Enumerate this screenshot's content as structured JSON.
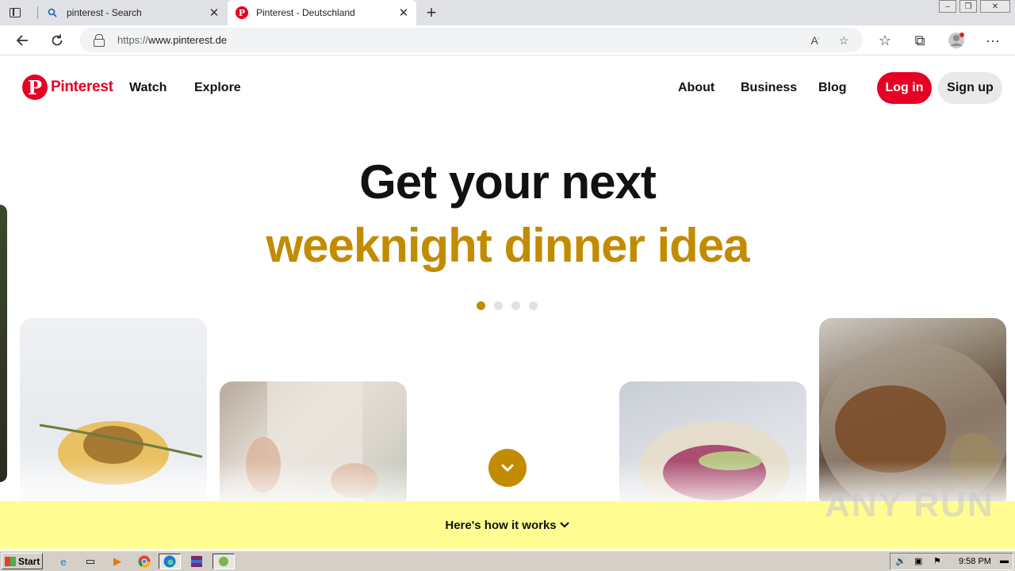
{
  "browser": {
    "tabs": [
      {
        "title": "pinterest - Search",
        "icon": "search-icon"
      },
      {
        "title": "Pinterest - Deutschland",
        "icon": "pinterest-icon"
      }
    ],
    "url_protocol": "https://",
    "url_host": "www.pinterest.de"
  },
  "header": {
    "logo_text": "Pinterest",
    "nav_left": [
      "Watch",
      "Explore"
    ],
    "nav_right": [
      "About",
      "Business",
      "Blog"
    ],
    "login_label": "Log in",
    "signup_label": "Sign up"
  },
  "hero": {
    "headline": "Get your next",
    "subline": "weeknight dinner idea",
    "accent_color": "#c28b00",
    "dot_count": 4,
    "active_dot": 0
  },
  "footer_band": {
    "label": "Here's how it works",
    "background": "#fffd92"
  },
  "watermark": "ANY RUN",
  "taskbar": {
    "start_label": "Start",
    "clock": "9:58 PM"
  },
  "colors": {
    "brand": "#e60023"
  }
}
